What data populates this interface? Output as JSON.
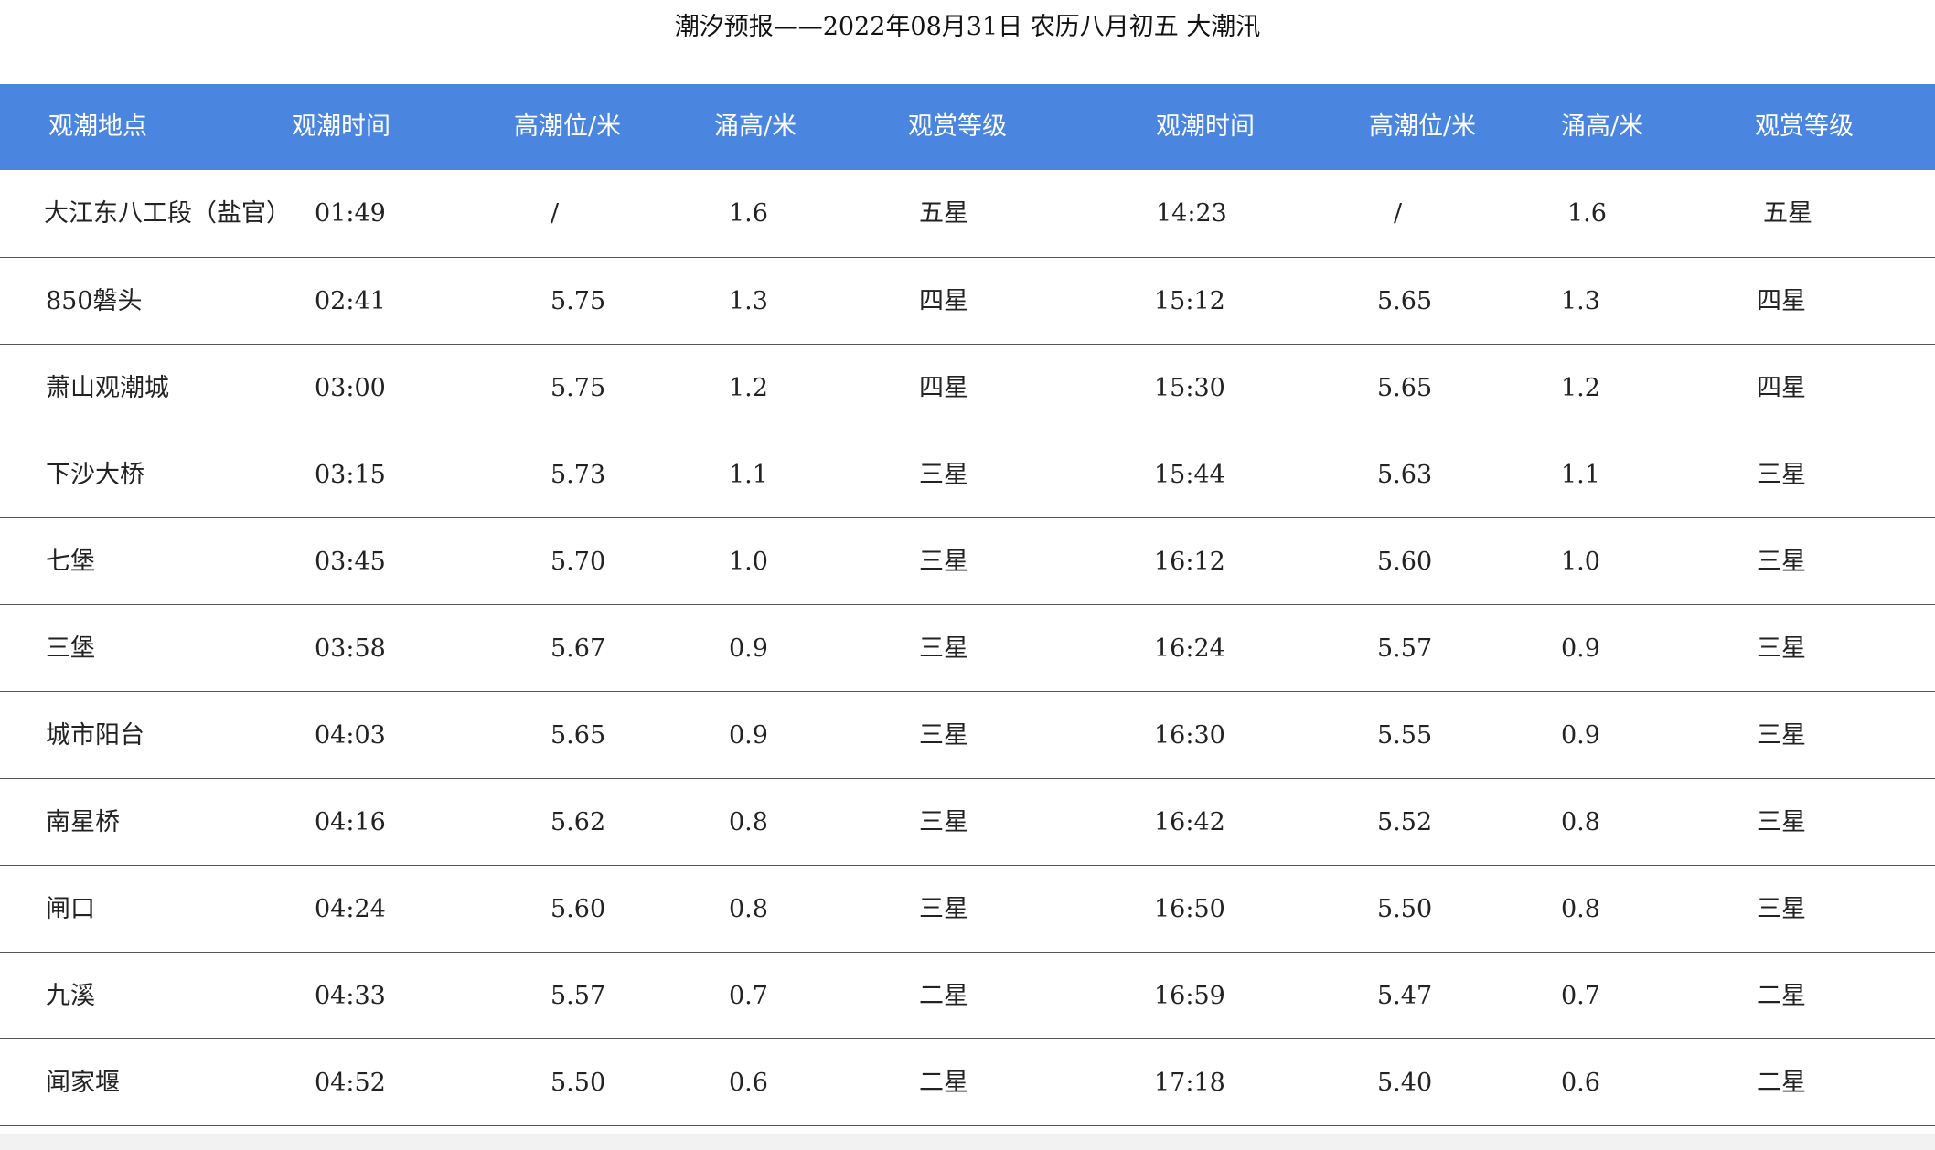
{
  "title": "潮汐预报——2022年08月31日 农历八月初五 大潮汛",
  "header": {
    "location": "观潮地点",
    "time1": "观潮时间",
    "high1": "高潮位/米",
    "surge1": "涌高/米",
    "rating1": "观赏等级",
    "time2": "观潮时间",
    "high2": "高潮位/米",
    "surge2": "涌高/米",
    "rating2": "观赏等级"
  },
  "rows": [
    {
      "location": "大江东八工段（盐官）",
      "time1": "01:49",
      "high1": "/",
      "surge1": "1.6",
      "rating1": "五星",
      "time2": "14:23",
      "high2": "/",
      "surge2": "1.6",
      "rating2": "五星"
    },
    {
      "location": "850磐头",
      "time1": "02:41",
      "high1": "5.75",
      "surge1": "1.3",
      "rating1": "四星",
      "time2": "15:12",
      "high2": "5.65",
      "surge2": "1.3",
      "rating2": "四星"
    },
    {
      "location": "萧山观潮城",
      "time1": "03:00",
      "high1": "5.75",
      "surge1": "1.2",
      "rating1": "四星",
      "time2": "15:30",
      "high2": "5.65",
      "surge2": "1.2",
      "rating2": "四星"
    },
    {
      "location": "下沙大桥",
      "time1": "03:15",
      "high1": "5.73",
      "surge1": "1.1",
      "rating1": "三星",
      "time2": "15:44",
      "high2": "5.63",
      "surge2": "1.1",
      "rating2": "三星"
    },
    {
      "location": "七堡",
      "time1": "03:45",
      "high1": "5.70",
      "surge1": "1.0",
      "rating1": "三星",
      "time2": "16:12",
      "high2": "5.60",
      "surge2": "1.0",
      "rating2": "三星"
    },
    {
      "location": "三堡",
      "time1": "03:58",
      "high1": "5.67",
      "surge1": "0.9",
      "rating1": "三星",
      "time2": "16:24",
      "high2": "5.57",
      "surge2": "0.9",
      "rating2": "三星"
    },
    {
      "location": "城市阳台",
      "time1": "04:03",
      "high1": "5.65",
      "surge1": "0.9",
      "rating1": "三星",
      "time2": "16:30",
      "high2": "5.55",
      "surge2": "0.9",
      "rating2": "三星"
    },
    {
      "location": "南星桥",
      "time1": "04:16",
      "high1": "5.62",
      "surge1": "0.8",
      "rating1": "三星",
      "time2": "16:42",
      "high2": "5.52",
      "surge2": "0.8",
      "rating2": "三星"
    },
    {
      "location": "闸口",
      "time1": "04:24",
      "high1": "5.60",
      "surge1": "0.8",
      "rating1": "三星",
      "time2": "16:50",
      "high2": "5.50",
      "surge2": "0.8",
      "rating2": "三星"
    },
    {
      "location": "九溪",
      "time1": "04:33",
      "high1": "5.57",
      "surge1": "0.7",
      "rating1": "二星",
      "time2": "16:59",
      "high2": "5.47",
      "surge2": "0.7",
      "rating2": "二星"
    },
    {
      "location": "闻家堰",
      "time1": "04:52",
      "high1": "5.50",
      "surge1": "0.6",
      "rating1": "二星",
      "time2": "17:18",
      "high2": "5.40",
      "surge2": "0.6",
      "rating2": "二星"
    }
  ],
  "colors": {
    "header_bg": "#4a86e0",
    "header_text": "#ffffff",
    "row_divider": "#555555"
  }
}
